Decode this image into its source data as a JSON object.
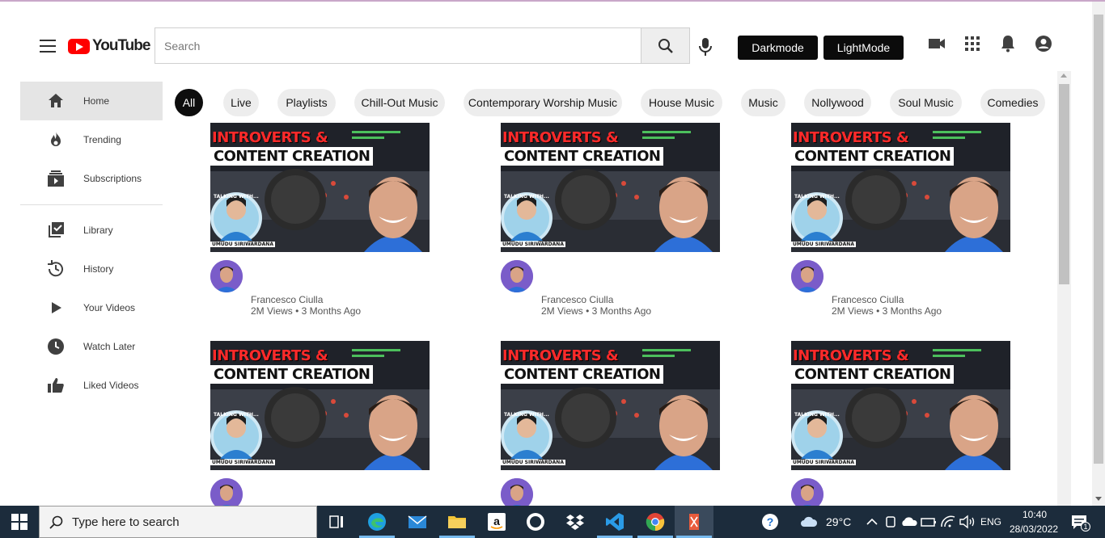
{
  "header": {
    "logo_text": "YouTube",
    "search_placeholder": "Search",
    "darkmode_label": "Darkmode",
    "lightmode_label": "LightMode"
  },
  "sidebar": {
    "items": [
      {
        "label": "Home",
        "icon": "home-icon"
      },
      {
        "label": "Trending",
        "icon": "flame-icon"
      },
      {
        "label": "Subscriptions",
        "icon": "subscriptions-icon"
      },
      {
        "label": "Library",
        "icon": "library-icon"
      },
      {
        "label": "History",
        "icon": "history-icon"
      },
      {
        "label": "Your Videos",
        "icon": "play-icon"
      },
      {
        "label": "Watch Later",
        "icon": "clock-icon"
      },
      {
        "label": "Liked Videos",
        "icon": "thumbs-up-icon"
      }
    ]
  },
  "chips": [
    "All",
    "Live",
    "Playlists",
    "Chill-Out Music",
    "Contemporary Worship Music",
    "House Music",
    "Music",
    "Nollywood",
    "Soul Music",
    "Comedies"
  ],
  "videos": [
    {
      "thumb_line1": "INTROVERTS &",
      "thumb_line2": "CONTENT CREATION",
      "thumb_small": "TALKING WITH...",
      "thumb_name": "UMUDU SIRIWARDANA",
      "channel": "Francesco Ciulla",
      "stats": "2M Views • 3 Months Ago"
    },
    {
      "thumb_line1": "INTROVERTS &",
      "thumb_line2": "CONTENT CREATION",
      "thumb_small": "TALKING WITH...",
      "thumb_name": "UMUDU SIRIWARDANA",
      "channel": "Francesco Ciulla",
      "stats": "2M Views • 3 Months Ago"
    },
    {
      "thumb_line1": "INTROVERTS &",
      "thumb_line2": "CONTENT CREATION",
      "thumb_small": "TALKING WITH...",
      "thumb_name": "UMUDU SIRIWARDANA",
      "channel": "Francesco Ciulla",
      "stats": "2M Views • 3 Months Ago"
    },
    {
      "thumb_line1": "INTROVERTS &",
      "thumb_line2": "CONTENT CREATION",
      "thumb_small": "TALKING WITH...",
      "thumb_name": "UMUDU SIRIWARDANA",
      "channel": "",
      "stats": ""
    },
    {
      "thumb_line1": "INTROVERTS &",
      "thumb_line2": "CONTENT CREATION",
      "thumb_small": "TALKING WITH...",
      "thumb_name": "UMUDU SIRIWARDANA",
      "channel": "",
      "stats": ""
    },
    {
      "thumb_line1": "INTROVERTS &",
      "thumb_line2": "CONTENT CREATION",
      "thumb_small": "TALKING WITH...",
      "thumb_name": "UMUDU SIRIWARDANA",
      "channel": "",
      "stats": ""
    }
  ],
  "taskbar": {
    "search_placeholder": "Type here to search",
    "weather": "29°C",
    "language": "ENG",
    "time": "10:40",
    "date": "28/03/2022",
    "notification_count": "1"
  },
  "colors": {
    "brand_red": "#ff0000",
    "button_dark": "#0b0b0b",
    "chip_bg": "#ededed",
    "taskbar_bg": "#1c2c3c"
  }
}
